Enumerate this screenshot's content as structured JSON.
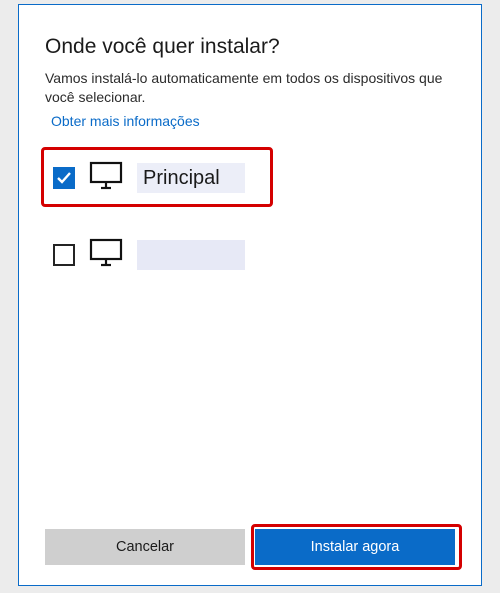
{
  "dialog": {
    "title": "Onde você quer instalar?",
    "subtitle": "Vamos instalá-lo automaticamente em todos os dispositivos que você selecionar.",
    "more_info": "Obter mais informações"
  },
  "devices": [
    {
      "label": "Principal",
      "checked": true
    },
    {
      "label": "",
      "checked": false
    }
  ],
  "buttons": {
    "cancel": "Cancelar",
    "install": "Instalar agora"
  }
}
